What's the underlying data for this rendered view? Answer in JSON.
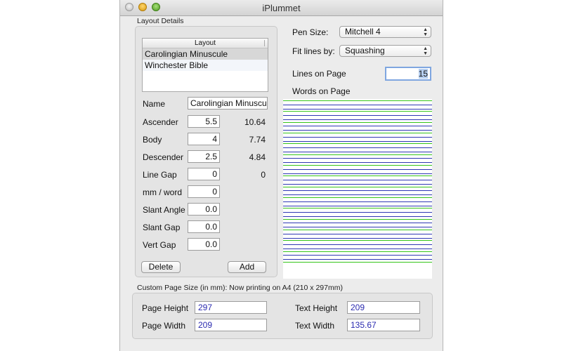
{
  "window": {
    "title": "iPlummet"
  },
  "layout_details": {
    "section_label": "Layout Details",
    "list_header": "Layout",
    "items": [
      "Carolingian Minuscule",
      "Winchester Bible"
    ],
    "selected_index": 0,
    "name_label": "Name",
    "name_value": "Carolingian Minuscule",
    "fields": [
      {
        "label": "Ascender",
        "value": "5.5",
        "computed": "10.64"
      },
      {
        "label": "Body",
        "value": "4",
        "computed": "7.74"
      },
      {
        "label": "Descender",
        "value": "2.5",
        "computed": "4.84"
      },
      {
        "label": "Line Gap",
        "value": "0",
        "computed": "0"
      },
      {
        "label": "mm / word",
        "value": "0"
      },
      {
        "label": "Slant Angle",
        "value": "0.0"
      },
      {
        "label": "Slant Gap",
        "value": "0.0"
      },
      {
        "label": "Vert Gap",
        "value": "0.0"
      }
    ],
    "delete_label": "Delete",
    "add_label": "Add"
  },
  "controls": {
    "pen_size_label": "Pen Size:",
    "pen_size_value": "Mitchell 4",
    "fit_lines_label": "Fit lines by:",
    "fit_lines_value": "Squashing",
    "lines_on_page_label": "Lines on Page",
    "lines_on_page_value": "15",
    "words_on_page_label": "Words on Page"
  },
  "preview": {
    "line_count": 15,
    "colors": {
      "guide": "#35c51a",
      "body": "#2f38b4"
    }
  },
  "custom_page": {
    "section_label": "Custom Page Size (in mm):  Now printing on A4 (210 x 297mm)",
    "page_height_label": "Page Height",
    "page_height_value": "297",
    "page_width_label": "Page Width",
    "page_width_value": "209",
    "text_height_label": "Text Height",
    "text_height_value": "209",
    "text_width_label": "Text Width",
    "text_width_value": "135.67"
  }
}
